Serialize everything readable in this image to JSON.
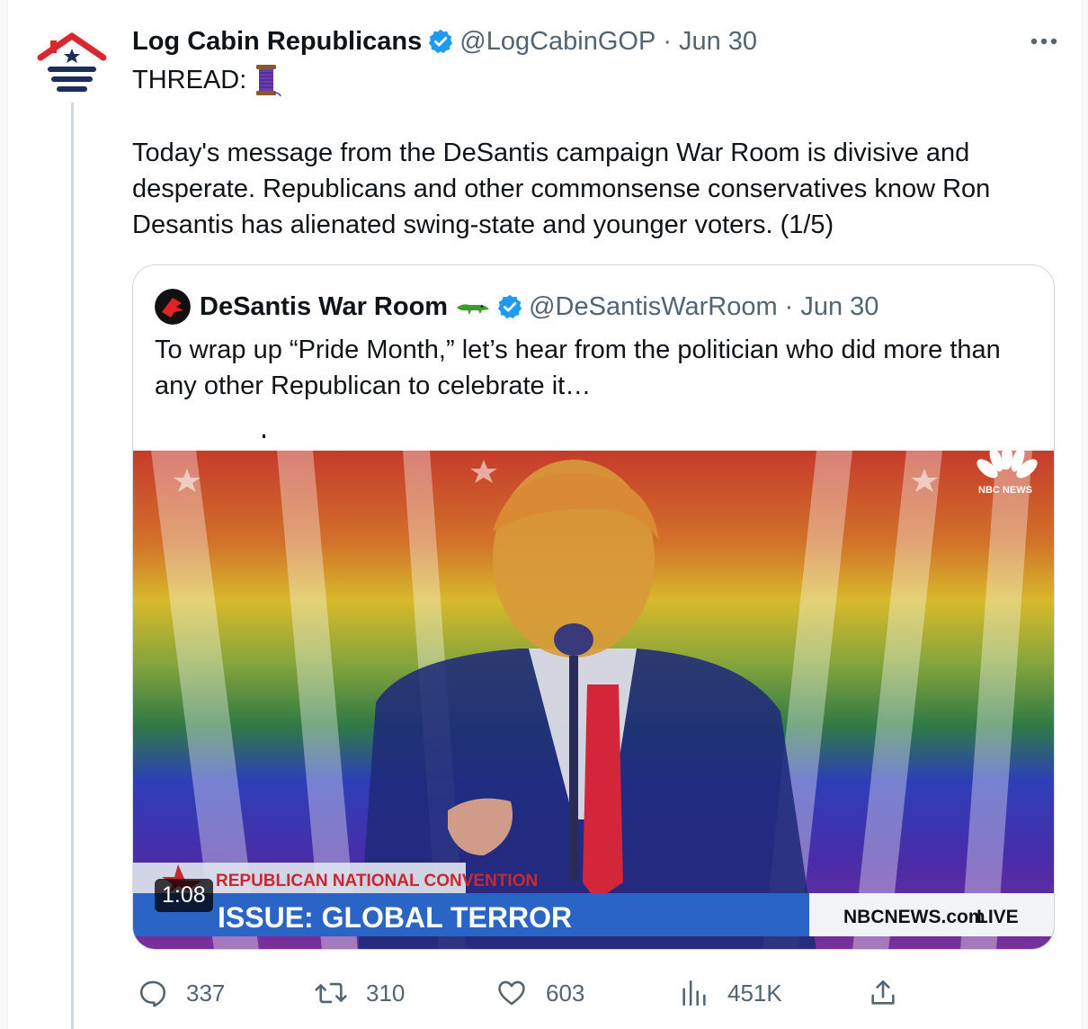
{
  "tweet": {
    "display_name": "Log Cabin Republicans",
    "handle": "@LogCabinGOP",
    "separator": "·",
    "date": "Jun 30",
    "thread_label": "THREAD:",
    "thread_emoji_icon": "spool-of-thread-icon",
    "text": "Today's message from the DeSantis campaign War Room is divisive and desperate. Republicans and other commonsense conservatives know Ron Desantis has alienated swing-state and younger voters. (1/5)"
  },
  "quote": {
    "display_name": "DeSantis War Room",
    "name_emoji_icon": "crocodile-icon",
    "handle": "@DeSantisWarRoom",
    "separator": "·",
    "date": "Jun 30",
    "text": "To wrap up “Pride Month,” let’s hear from the politician who did more than any other Republican to celebrate it…",
    "video": {
      "duration": "1:08",
      "network_logo": "NBC NEWS",
      "lower_third_top": "REPUBLICAN NATIONAL CONVENTION",
      "lower_third_main": "ISSUE: GLOBAL TERROR",
      "network_site": "NBCNEWS.com",
      "live_label": "LIVE"
    }
  },
  "actions": {
    "replies": "337",
    "retweets": "310",
    "likes": "603",
    "views": "451K"
  },
  "colors": {
    "verified_blue": "#1d9bf0",
    "secondary_text": "#536471",
    "border": "#cfd9de",
    "logo_red": "#d7282f",
    "logo_navy": "#1c2e5a"
  }
}
